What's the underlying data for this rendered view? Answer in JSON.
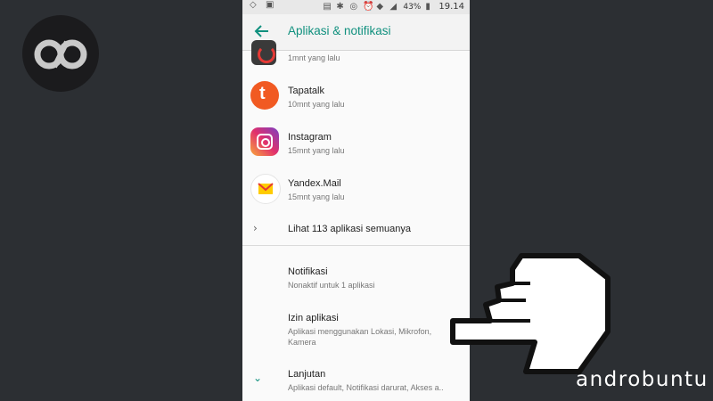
{
  "status": {
    "battery": "43%",
    "time": "19.14"
  },
  "appbar": {
    "title": "Aplikasi & notifikasi"
  },
  "apps": [
    {
      "name": "",
      "time": "1mnt yang lalu",
      "icon": "red-app-icon"
    },
    {
      "name": "Tapatalk",
      "time": "10mnt yang lalu",
      "icon": "tapatalk-icon"
    },
    {
      "name": "Instagram",
      "time": "15mnt yang lalu",
      "icon": "instagram-icon"
    },
    {
      "name": "Yandex.Mail",
      "time": "15mnt yang lalu",
      "icon": "yandex-mail-icon"
    }
  ],
  "see_all": "Lihat 113 aplikasi semuanya",
  "settings": [
    {
      "title": "Notifikasi",
      "subtitle": "Nonaktif untuk 1 aplikasi"
    },
    {
      "title": "Izin aplikasi",
      "subtitle": "Aplikasi menggunakan Lokasi, Mikrofon,",
      "subtitle2": "Kamera"
    },
    {
      "title": "Lanjutan",
      "subtitle": "Aplikasi default, Notifikasi darurat, Akses a.."
    }
  ],
  "brand": "androbuntu"
}
